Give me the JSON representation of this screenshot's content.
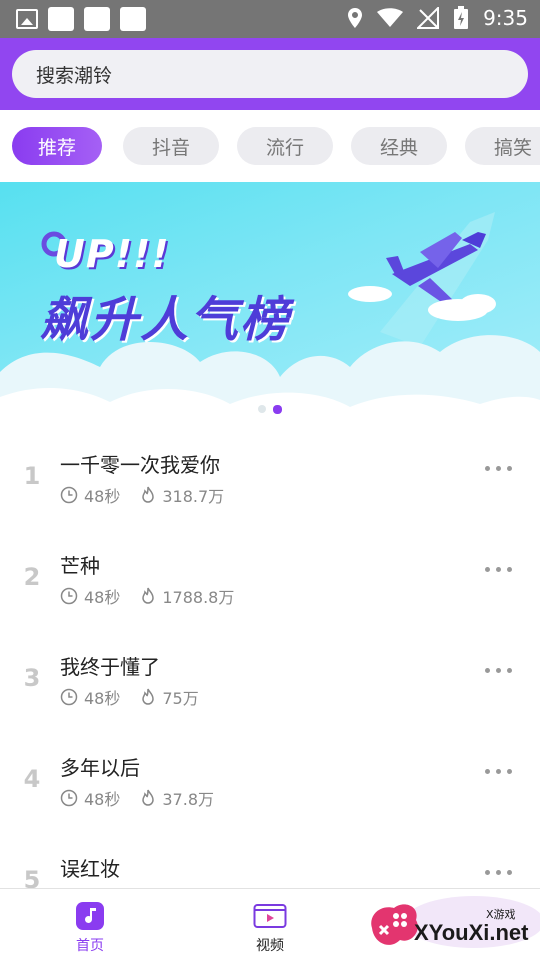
{
  "status_bar": {
    "time": "9:35"
  },
  "search": {
    "placeholder": "搜索潮铃"
  },
  "tabs": [
    {
      "label": "推荐",
      "active": true
    },
    {
      "label": "抖音"
    },
    {
      "label": "流行"
    },
    {
      "label": "经典"
    },
    {
      "label": "搞笑"
    }
  ],
  "banner": {
    "up_text": "UP!!!",
    "title": "飙升人气榜",
    "page_index": 2,
    "page_count": 2
  },
  "songs": [
    {
      "rank": "1",
      "title": "一千零一次我爱你",
      "duration": "48秒",
      "plays": "318.7万"
    },
    {
      "rank": "2",
      "title": "芒种",
      "duration": "48秒",
      "plays": "1788.8万"
    },
    {
      "rank": "3",
      "title": "我终于懂了",
      "duration": "48秒",
      "plays": "75万"
    },
    {
      "rank": "4",
      "title": "多年以后",
      "duration": "48秒",
      "plays": "37.8万"
    },
    {
      "rank": "5",
      "title": "误红妆",
      "duration": "",
      "plays": ""
    }
  ],
  "bottom_nav": [
    {
      "label": "首页",
      "icon": "music-note-icon",
      "active": true
    },
    {
      "label": "视频",
      "icon": "video-icon"
    }
  ],
  "watermark": {
    "brand": "XYouXi.net",
    "small": "X游戏"
  },
  "colors": {
    "accent": "#8a3cf0",
    "header": "#9146f0",
    "banner_sky": "#7fe6f5",
    "title_blue": "#4e3dd8"
  }
}
